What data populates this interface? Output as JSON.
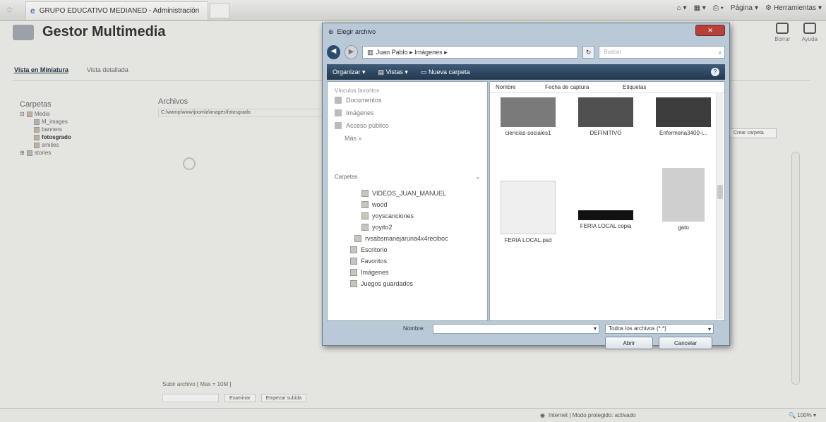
{
  "browser": {
    "tab_title": "GRUPO EDUCATIVO MEDIANED - Administración",
    "tools": [
      "Página",
      "Herramientas"
    ]
  },
  "header": {
    "title": "Gestor Multimedia",
    "buttons": [
      {
        "label": "Borrar"
      },
      {
        "label": "Ayuda"
      }
    ]
  },
  "tabs": {
    "miniatura": "Vista en Miniatura",
    "detallada": "Vista detallada"
  },
  "folders": {
    "title": "Carpetas",
    "items": [
      "Media",
      "M_images",
      "banners",
      "fotosgrado",
      "smilies",
      "stories"
    ]
  },
  "files": {
    "title": "Archivos",
    "path": "C:\\wamp\\www\\joomla\\images\\fotosgrado",
    "create_folder": "Crear carpeta"
  },
  "upload": {
    "label": "Subir archivo [ Max = 10M ]",
    "browse": "Examinar",
    "start": "Empezar subida"
  },
  "statusbar": {
    "zone": "Internet | Modo protegido: activado",
    "zoom": "100%"
  },
  "dialog": {
    "title": "Elegir archivo",
    "address": "Juan Pablo ▸ Imágenes ▸",
    "search_placeholder": "Buscar",
    "toolbar": {
      "organize": "Organizar",
      "views": "Vistas",
      "new_folder": "Nueva carpeta"
    },
    "favorites_title": "Vínculos favoritos",
    "favorites": [
      "Documentos",
      "Imágenes",
      "Acceso público"
    ],
    "more": "Más »",
    "folders_title": "Carpetas",
    "tree": [
      "VIDEOS_JUAN_MANUEL",
      "wood",
      "yoyscanciones",
      "yoyito2",
      "rvsabsmanejaruna4x4reciboc",
      "Escritorio",
      "Favoritos",
      "Imágenes",
      "Juegos guardados"
    ],
    "columns": [
      "Nombre",
      "Fecha de captura",
      "Etiquetas"
    ],
    "thumbnails": [
      {
        "name": "ciencias-sociales1",
        "color": "#7a7a7a"
      },
      {
        "name": "DEFINITIVO",
        "color": "#505050"
      },
      {
        "name": "Enfermeria3400-i...",
        "color": "#3c3c3c"
      },
      {
        "name": "FERIA LOCAL.psd",
        "color": "#efefef"
      },
      {
        "name": "FERIA LOCAL copia",
        "color": "#111111"
      },
      {
        "name": "gato",
        "color": "#cfcfcf"
      }
    ],
    "name_label": "Nombre:",
    "filter": "Todos los archivos (*.*)",
    "open": "Abrir",
    "cancel": "Cancelar"
  }
}
